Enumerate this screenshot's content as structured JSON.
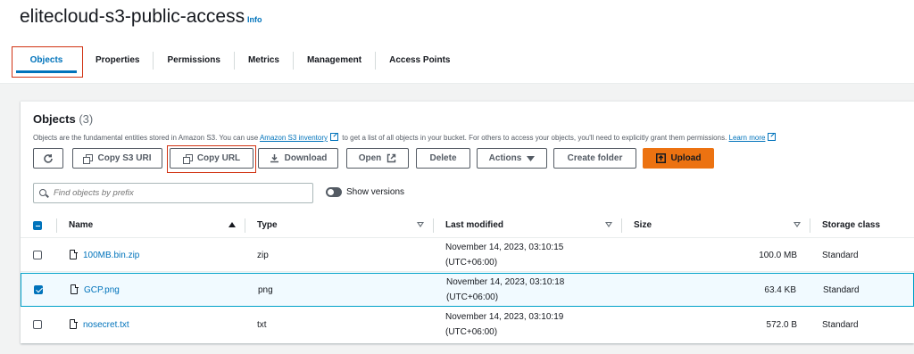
{
  "bucket": {
    "name": "elitecloud-s3-public-access",
    "info_label": "Info"
  },
  "tabs": [
    {
      "label": "Objects",
      "active": true
    },
    {
      "label": "Properties"
    },
    {
      "label": "Permissions"
    },
    {
      "label": "Metrics"
    },
    {
      "label": "Management"
    },
    {
      "label": "Access Points"
    }
  ],
  "objects_panel": {
    "title": "Objects",
    "count": "(3)",
    "description_pre": "Objects are the fundamental entities stored in Amazon S3. You can use ",
    "description_link": "Amazon S3 inventory",
    "description_mid": " to get a list of all objects in your bucket. For others to access your objects, you'll need to explicitly grant them permissions. ",
    "learn_more": "Learn more"
  },
  "toolbar": {
    "copy_s3_uri": "Copy S3 URI",
    "copy_url": "Copy URL",
    "download": "Download",
    "open": "Open",
    "delete": "Delete",
    "actions": "Actions",
    "create_folder": "Create folder",
    "upload": "Upload"
  },
  "search": {
    "placeholder": "Find objects by prefix"
  },
  "show_versions": {
    "label": "Show versions",
    "enabled": false
  },
  "table": {
    "columns": [
      "Name",
      "Type",
      "Last modified",
      "Size",
      "Storage class"
    ],
    "rows": [
      {
        "name": "100MB.bin.zip",
        "type": "zip",
        "modified_date": "November 14, 2023, 03:10:15",
        "modified_tz": "(UTC+06:00)",
        "size": "100.0 MB",
        "storage": "Standard",
        "selected": false
      },
      {
        "name": "GCP.png",
        "type": "png",
        "modified_date": "November 14, 2023, 03:10:18",
        "modified_tz": "(UTC+06:00)",
        "size": "63.4 KB",
        "storage": "Standard",
        "selected": true
      },
      {
        "name": "nosecret.txt",
        "type": "txt",
        "modified_date": "November 14, 2023, 03:10:19",
        "modified_tz": "(UTC+06:00)",
        "size": "572.0 B",
        "storage": "Standard",
        "selected": false
      }
    ]
  },
  "colors": {
    "accent": "#0073bb",
    "upload": "#ec7211",
    "highlight": "#d13212"
  }
}
